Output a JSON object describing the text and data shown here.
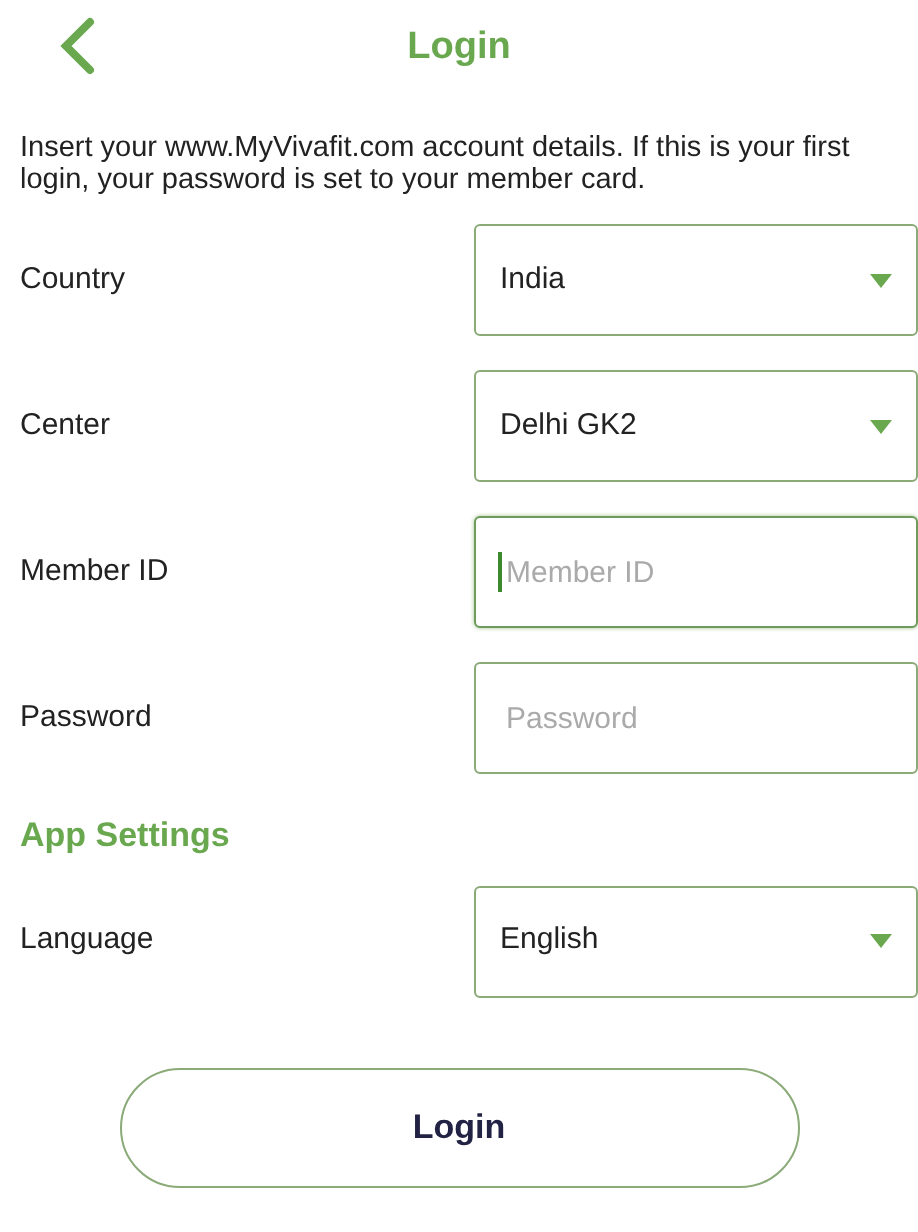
{
  "header": {
    "title": "Login"
  },
  "intro": "Insert your www.MyVivafit.com account details. If this is your first login, your password is set to your member card.",
  "fields": [
    {
      "label": "Country",
      "kind": "select",
      "value": "India"
    },
    {
      "label": "Center",
      "kind": "select",
      "value": "Delhi GK2"
    },
    {
      "label": "Member ID",
      "kind": "input",
      "placeholder": "Member ID",
      "focused": true
    },
    {
      "label": "Password",
      "kind": "input",
      "placeholder": "Password",
      "focused": false
    }
  ],
  "settings": {
    "title": "App Settings",
    "fields": [
      {
        "label": "Language",
        "kind": "select",
        "value": "English"
      }
    ]
  },
  "login_button": "Login"
}
